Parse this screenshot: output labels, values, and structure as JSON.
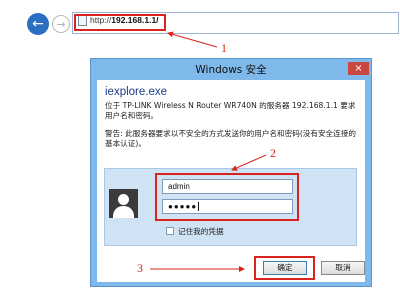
{
  "browser": {
    "address_prefix": "http://",
    "address_host": "192.168.1.1/",
    "back_icon": "arrow-left-icon",
    "forward_icon": "arrow-right-icon"
  },
  "annotations": {
    "label_1": "1",
    "label_2": "2",
    "label_3": "3",
    "color": "#d9231e"
  },
  "dialog": {
    "title": "Windows 安全",
    "close_label": "×",
    "app_name": "iexplore.exe",
    "description": "位于 TP-LINK Wireless N Router WR740N 的服务器 192.168.1.1 要求用户名和密码。",
    "warning": "警告: 此服务器要求以不安全的方式发送你的用户名和密码(没有安全连接的基本认证)。",
    "username_value": "admin",
    "password_mask": "●●●●●",
    "remember_label": "记住我的凭据",
    "ok_label": "确定",
    "cancel_label": "取消",
    "accent_color": "#7fb8ea"
  }
}
